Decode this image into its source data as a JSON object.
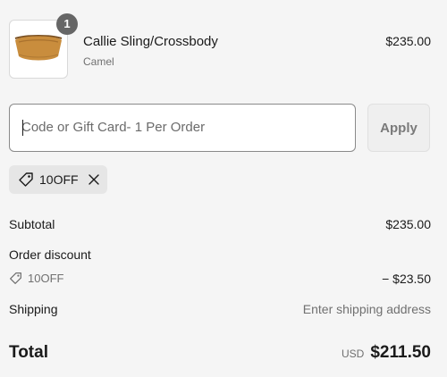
{
  "product": {
    "name": "Callie Sling/Crossbody",
    "variant": "Camel",
    "price": "$235.00",
    "quantity": "1"
  },
  "discount": {
    "placeholder": "Code or Gift Card- 1 Per Order",
    "apply_label": "Apply",
    "applied_code": "10OFF"
  },
  "summary": {
    "subtotal_label": "Subtotal",
    "subtotal_value": "$235.00",
    "order_discount_label": "Order discount",
    "discount_code": "10OFF",
    "discount_value": "− $23.50",
    "shipping_label": "Shipping",
    "shipping_value": "Enter shipping address",
    "total_label": "Total",
    "currency": "USD",
    "total_value": "$211.50"
  },
  "icons": {
    "tag": "tag-icon",
    "remove": "close-icon"
  },
  "colors": {
    "background": "#f5f5f5",
    "badge": "#666666",
    "chip": "#e6e6e6",
    "input_border": "#8a8a8a"
  }
}
